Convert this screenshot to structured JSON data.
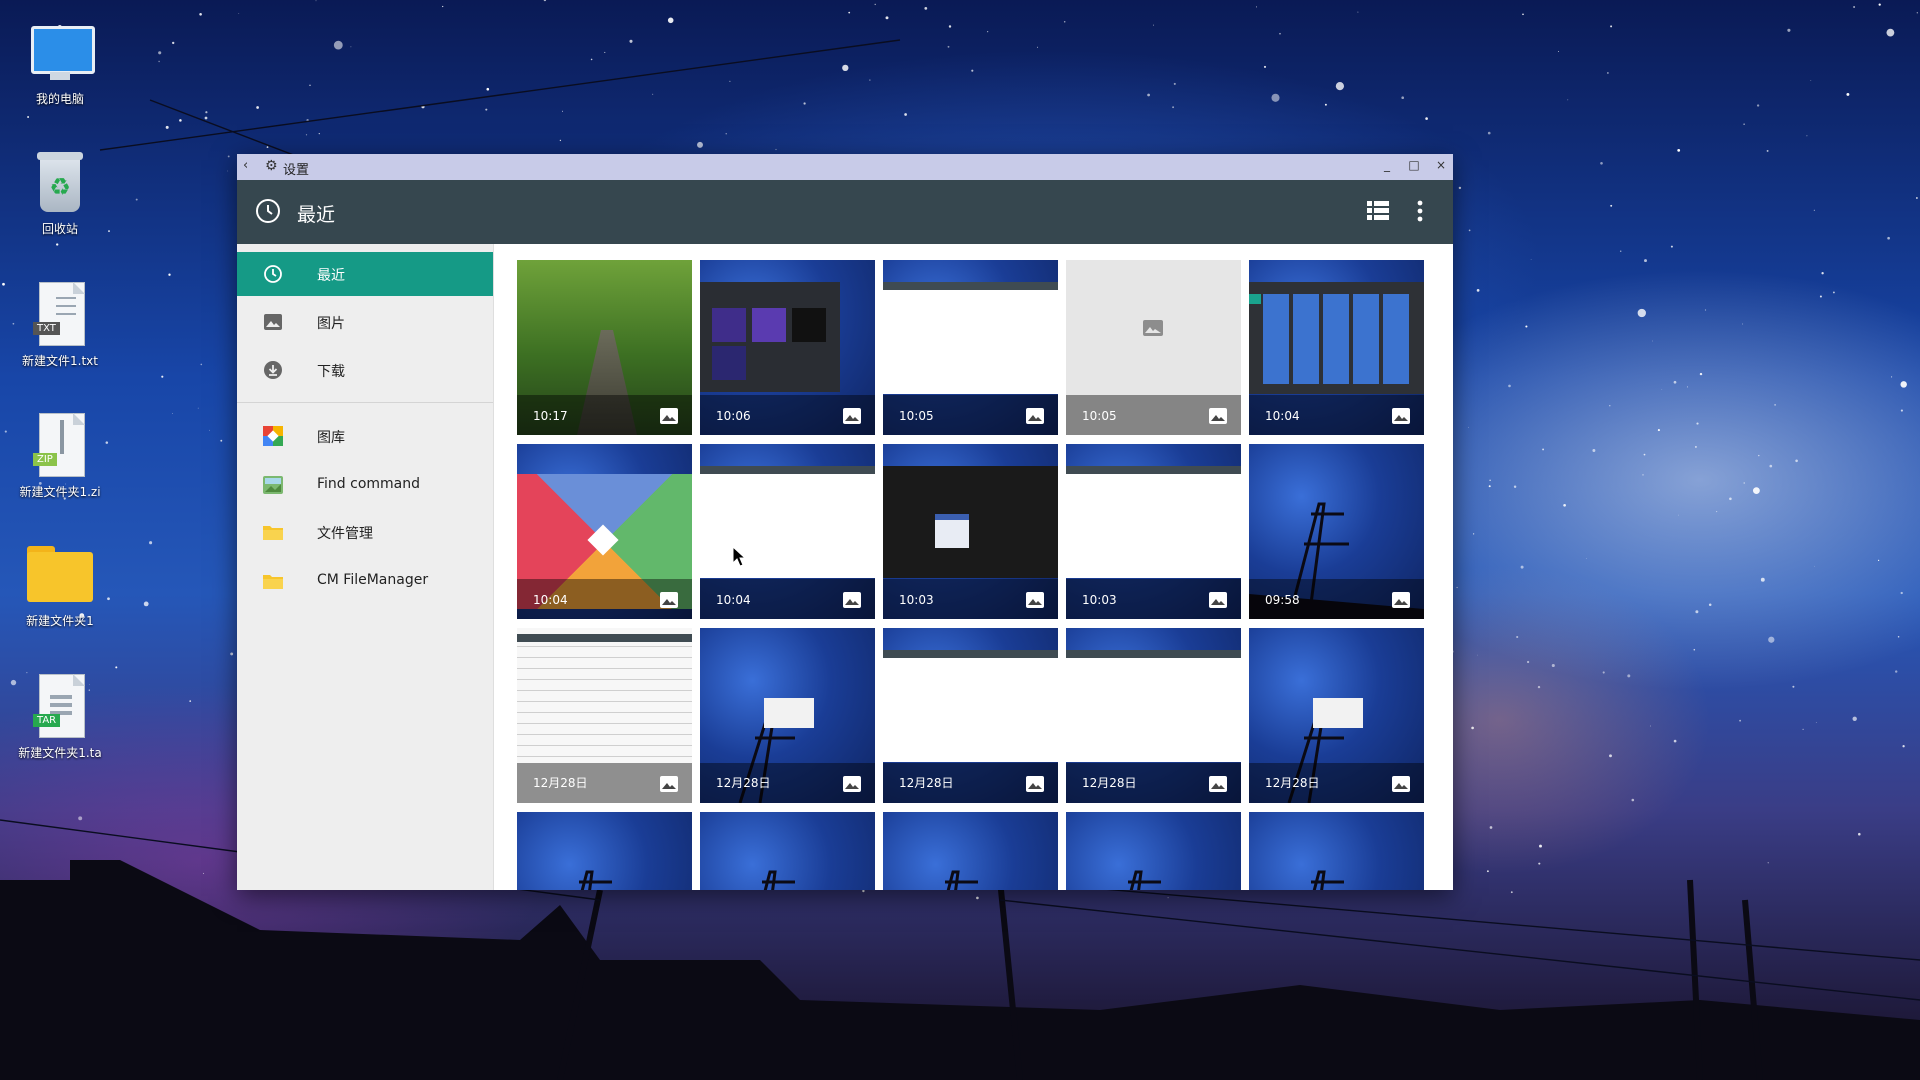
{
  "desktop": {
    "icons": [
      {
        "label": "我的电脑",
        "icon": "computer-icon"
      },
      {
        "label": "回收站",
        "icon": "recycle-bin-icon"
      },
      {
        "label": "新建文件1.txt",
        "icon": "txt-file-icon",
        "tag": "TXT"
      },
      {
        "label": "新建文件夹1.zi",
        "icon": "zip-file-icon",
        "tag": "ZIP"
      },
      {
        "label": "新建文件夹1",
        "icon": "folder-icon"
      },
      {
        "label": "新建文件夹1.ta",
        "icon": "tar-file-icon",
        "tag": "TAR"
      }
    ]
  },
  "window": {
    "title": "设置",
    "back_icon": "back-arrow-icon",
    "settings_icon": "gear-icon",
    "controls": {
      "minimize": "_",
      "maximize": "□",
      "close": "×"
    }
  },
  "toolbar": {
    "title": "最近",
    "title_icon": "clock-icon",
    "actions": [
      "list-view-icon",
      "more-vert-icon"
    ]
  },
  "sidebar": {
    "items": [
      {
        "label": "最近",
        "icon": "clock-icon",
        "active": true
      },
      {
        "label": "图片",
        "icon": "image-icon",
        "active": false
      },
      {
        "label": "下载",
        "icon": "download-icon",
        "active": false
      },
      {
        "label": "图库",
        "icon": "gallery-app-icon",
        "active": false
      },
      {
        "label": "Find command",
        "icon": "find-command-app-icon",
        "active": false
      },
      {
        "label": "文件管理",
        "icon": "folder-icon",
        "active": false
      },
      {
        "label": "CM FileManager",
        "icon": "folder-icon",
        "active": false
      }
    ]
  },
  "thumbnails": [
    {
      "time": "10:17",
      "kind": "forest-road"
    },
    {
      "time": "10:06",
      "kind": "screenshot-dark-gallery"
    },
    {
      "time": "10:05",
      "kind": "screenshot-white-window"
    },
    {
      "time": "10:05",
      "kind": "placeholder"
    },
    {
      "time": "10:04",
      "kind": "screenshot-thumb-grid"
    },
    {
      "time": "10:04",
      "kind": "colorful-logo"
    },
    {
      "time": "10:04",
      "kind": "screenshot-white-window"
    },
    {
      "time": "10:03",
      "kind": "screenshot-black-dialog"
    },
    {
      "time": "10:03",
      "kind": "screenshot-white-window"
    },
    {
      "time": "09:58",
      "kind": "starry-sky"
    },
    {
      "time": "12月28日",
      "kind": "screenshot-list"
    },
    {
      "time": "12月28日",
      "kind": "starry-sky-dialog"
    },
    {
      "time": "12月28日",
      "kind": "screenshot-white-window"
    },
    {
      "time": "12月28日",
      "kind": "screenshot-white-window"
    },
    {
      "time": "12月28日",
      "kind": "starry-sky-dialog"
    },
    {
      "time": "",
      "kind": "starry-sky"
    },
    {
      "time": "",
      "kind": "starry-sky"
    },
    {
      "time": "",
      "kind": "starry-sky"
    },
    {
      "time": "",
      "kind": "starry-sky"
    },
    {
      "time": "",
      "kind": "starry-sky"
    }
  ],
  "colors": {
    "accent": "#159a86",
    "toolbar": "#36474f",
    "titlebar": "#c8cbe8",
    "sidebar": "#eeeeee"
  }
}
